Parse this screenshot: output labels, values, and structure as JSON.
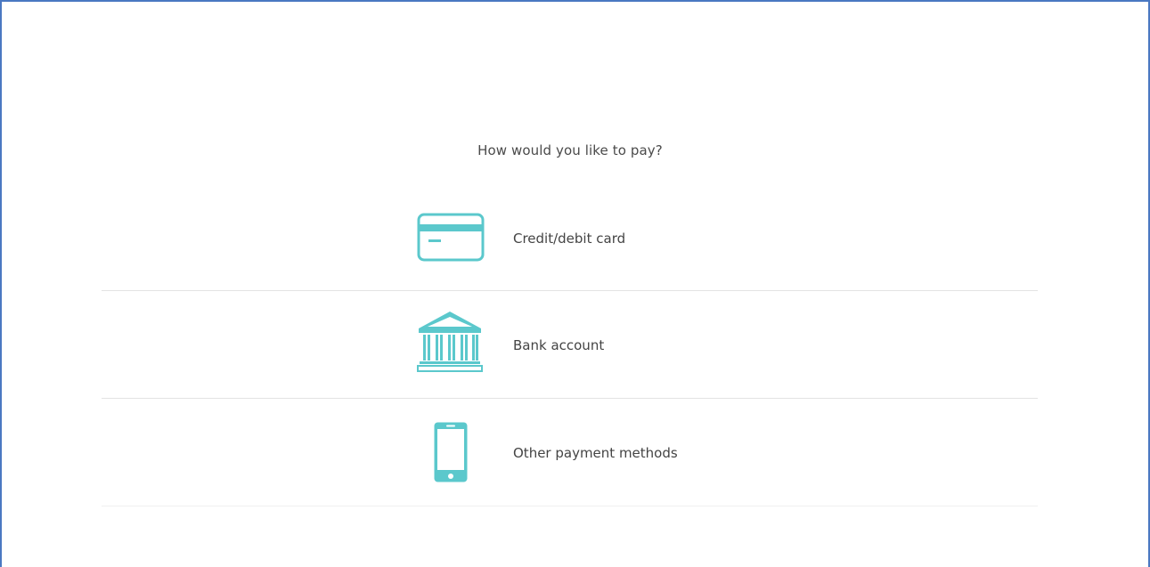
{
  "payment": {
    "question": "How would you like to pay?",
    "options": [
      {
        "label": "Credit/debit card",
        "icon": "credit-card-icon"
      },
      {
        "label": "Bank account",
        "icon": "bank-icon"
      },
      {
        "label": "Other payment methods",
        "icon": "smartphone-icon"
      }
    ]
  },
  "colors": {
    "accent": "#5bc8cc",
    "frame_border": "#4a78c2",
    "text": "#444444",
    "divider": "#e3e3e3"
  }
}
